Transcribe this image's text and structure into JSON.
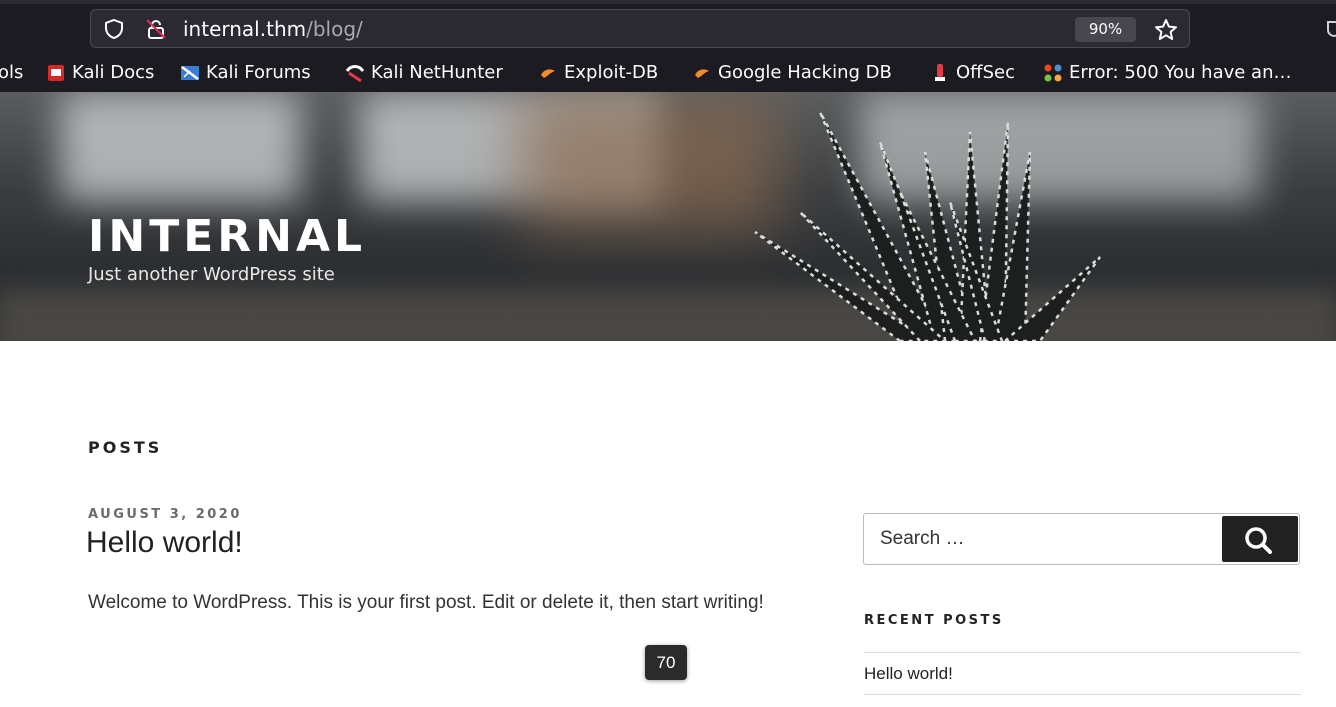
{
  "browser": {
    "url_host": "internal.thm",
    "url_path": "/blog/",
    "zoom": "90%",
    "bookmarks": [
      {
        "label": "ols",
        "icon": "truncated"
      },
      {
        "label": "Kali Docs",
        "icon": "kali-docs-icon"
      },
      {
        "label": "Kali Forums",
        "icon": "kali-forums-icon"
      },
      {
        "label": "Kali NetHunter",
        "icon": "kali-nethunter-icon"
      },
      {
        "label": "Exploit-DB",
        "icon": "exploit-db-icon"
      },
      {
        "label": "Google Hacking DB",
        "icon": "exploit-db-icon"
      },
      {
        "label": "OffSec",
        "icon": "offsec-icon"
      },
      {
        "label": "Error: 500 You have an…",
        "icon": "joomla-icon"
      }
    ]
  },
  "site": {
    "title": "INTERNAL",
    "description": "Just another WordPress site"
  },
  "main": {
    "section_heading": "POSTS",
    "post": {
      "date": "AUGUST 3, 2020",
      "title": "Hello world!",
      "excerpt": "Welcome to WordPress. This is your first post. Edit or delete it, then start writing!"
    }
  },
  "sidebar": {
    "search_placeholder": "Search …",
    "recent_heading": "RECENT POSTS",
    "recent_posts": [
      "Hello world!"
    ]
  },
  "overlay": {
    "badge": "70"
  },
  "colors": {
    "chrome_bg": "#1c1b22",
    "urlbar_bg": "#2b2a33",
    "text_dark": "#222222",
    "search_button": "#222222"
  }
}
